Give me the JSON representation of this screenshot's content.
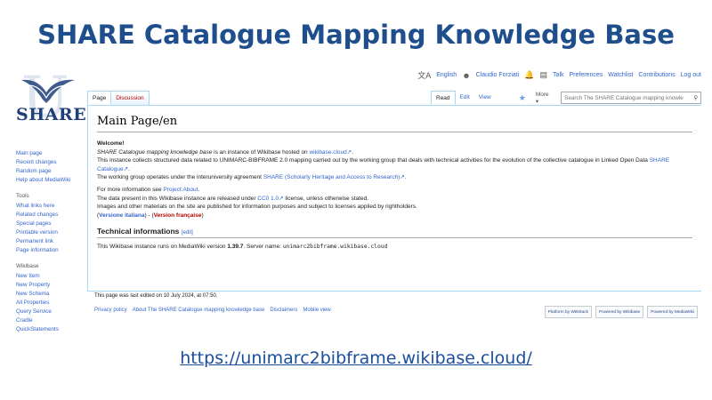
{
  "slide": {
    "title": "SHARE Catalogue Mapping Knowledge Base",
    "url": "https://unimarc2bibframe.wikibase.cloud/"
  },
  "logo": {
    "letter": "U",
    "text": "SHARE"
  },
  "personal": {
    "language": "English",
    "user": "Claudio Forziati",
    "talk": "Talk",
    "preferences": "Preferences",
    "watchlist": "Watchlist",
    "contributions": "Contributions",
    "logout": "Log out"
  },
  "sidebar": {
    "main": [
      "Main page",
      "Recent changes",
      "Random page",
      "Help about MediaWiki"
    ],
    "tools_heading": "Tools",
    "tools": [
      "What links here",
      "Related changes",
      "Special pages",
      "Printable version",
      "Permanent link",
      "Page information"
    ],
    "wikibase_heading": "Wikibase",
    "wikibase": [
      "New Item",
      "New Property",
      "New Schema",
      "All Properties",
      "Query Service",
      "Cradle",
      "QuickStatements"
    ]
  },
  "tabs": {
    "page": "Page",
    "discussion": "Discussion",
    "read": "Read",
    "edit": "Edit",
    "view_history": "View history",
    "more": "More ▾"
  },
  "search": {
    "placeholder": "Search The SHARE Catalogue mapping knowle"
  },
  "content": {
    "title": "Main Page/en",
    "welcome": "Welcome!",
    "p1_italic": "SHARE Catalogue mapping knowledge base",
    "p1_text": " is an instance of Wikibase hosted on ",
    "p1_link": "wikibase.cloud",
    "p2_text": "This instance collects structured data related to UNIMARC-BIBFRAME 2.0 mapping carried out by the working group that deals with technical activities for the evolution of the collective catalogue in Linked Open Data ",
    "p2_link": "SHARE Catalogue",
    "p3_text": "The working group operates under the interuniversity agreement ",
    "p3_link": "SHARE (Scholarly Heritage and Access to Research)",
    "p4_text": "For more information see ",
    "p4_link": "Project:About",
    "p5_text1": "The data present in this Wikibase instance are released under ",
    "p5_link": "CC0 1.0",
    "p5_text2": " license, unless otherwise stated.",
    "p6_text": "Images and other materials on the site are published for information purposes and subject to licenses applied by rightholders.",
    "version_it": "Versione italiana",
    "version_sep": " - ",
    "version_fr": "Version française",
    "section_title": "Technical informations",
    "section_edit": "edit",
    "tech_text1": "This Wikibase instance runs on MediaWiki version ",
    "tech_version": "1.39.7",
    "tech_text2": ". Server name: ",
    "tech_server": "unimarc2bibframe.wikibase.cloud"
  },
  "footer": {
    "last_edited": "This page was last edited on 10 July 2024, at 07:50.",
    "links": [
      "Privacy policy",
      "About The SHARE Catalogue mapping knowledge base",
      "Disclaimers",
      "Mobile view"
    ],
    "badges": [
      "Platform by WBStack",
      "Powered by Wikibase",
      "Powered by MediaWiki"
    ]
  }
}
